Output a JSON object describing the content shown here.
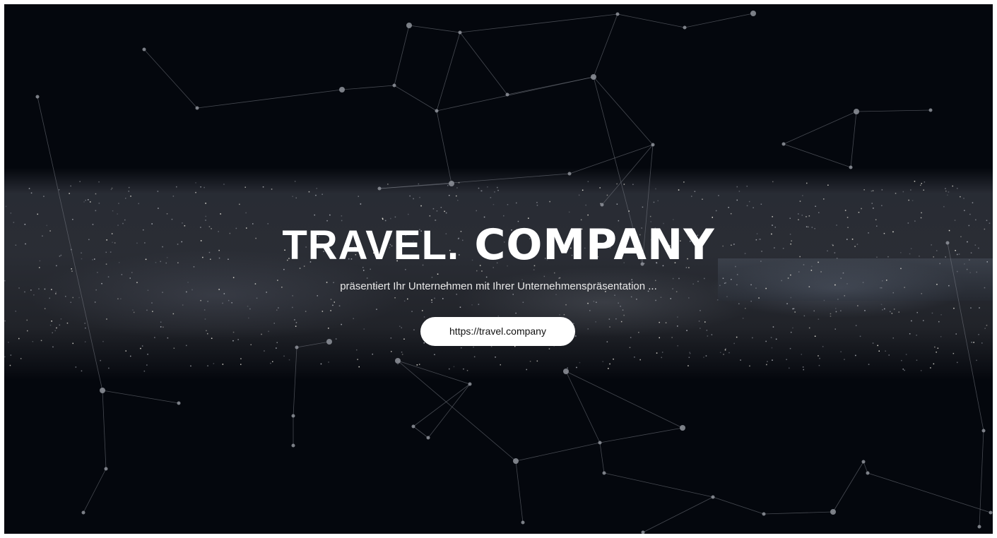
{
  "hero": {
    "title_part1": "TRAVEL.",
    "title_part2": "COMPANY",
    "subtitle": "präsentiert Ihr Unternehmen mit Ihrer Unternehmenspräsentation ...",
    "url_button_label": "https://travel.company"
  },
  "colors": {
    "background": "#04070d",
    "title": "#ffffff",
    "button_background": "#ffffff",
    "button_text": "#111111",
    "network_lines": "#6b6f78"
  }
}
